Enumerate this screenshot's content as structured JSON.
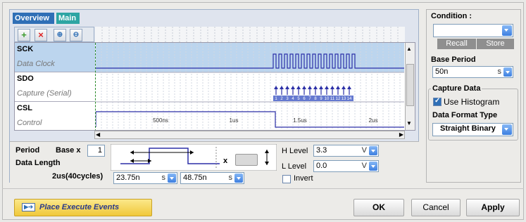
{
  "tabs": [
    {
      "label": "Overview"
    },
    {
      "label": "Main"
    }
  ],
  "toolbar": {
    "add_icon": "plus-icon",
    "delete_icon": "x-icon",
    "zoom_in_icon": "zoom-in-icon",
    "zoom_out_icon": "zoom-out-icon"
  },
  "signals": [
    {
      "name": "SCK",
      "desc": "Data Clock"
    },
    {
      "name": "SDO",
      "desc": "Capture (Serial)"
    },
    {
      "name": "CSL",
      "desc": "Control"
    }
  ],
  "capture_markers": [
    "1",
    "2",
    "3",
    "4",
    "5",
    "6",
    "7",
    "8",
    "9",
    "10",
    "11",
    "12",
    "13",
    "14"
  ],
  "time_labels": [
    "500ns",
    "1us",
    "1.5us",
    "2us"
  ],
  "params": {
    "period_label": "Period",
    "base_label": "Base x",
    "base_value": "1",
    "data_length_label": "Data Length",
    "data_length_value": "2us(40cycles)",
    "start_value": "23.75n",
    "start_unit": "s",
    "end_value": "48.75n",
    "end_unit": "s",
    "x_label": "x",
    "h_level_label": "H Level",
    "h_level_value": "3.3",
    "h_level_unit": "V",
    "l_level_label": "L Level",
    "l_level_value": "0.0",
    "l_level_unit": "V",
    "invert_label": "Invert"
  },
  "side": {
    "condition_label": "Condition :",
    "condition_value": "",
    "recall_label": "Recall",
    "store_label": "Store",
    "base_period_label": "Base Period",
    "base_period_value": "50n",
    "base_period_unit": "s",
    "capture_data_label": "Capture Data",
    "use_histogram_label": "Use Histogram",
    "data_format_label": "Data Format Type",
    "data_format_value": "Straight Binary"
  },
  "footer": {
    "place_execute_label": "Place Execute Events",
    "ok_label": "OK",
    "cancel_label": "Cancel",
    "apply_label": "Apply"
  },
  "colors": {
    "accent": "#2f6fb6",
    "wave": "#2b2fa7",
    "tab_main": "#2da5a3",
    "place_btn": "#f5d44a"
  }
}
